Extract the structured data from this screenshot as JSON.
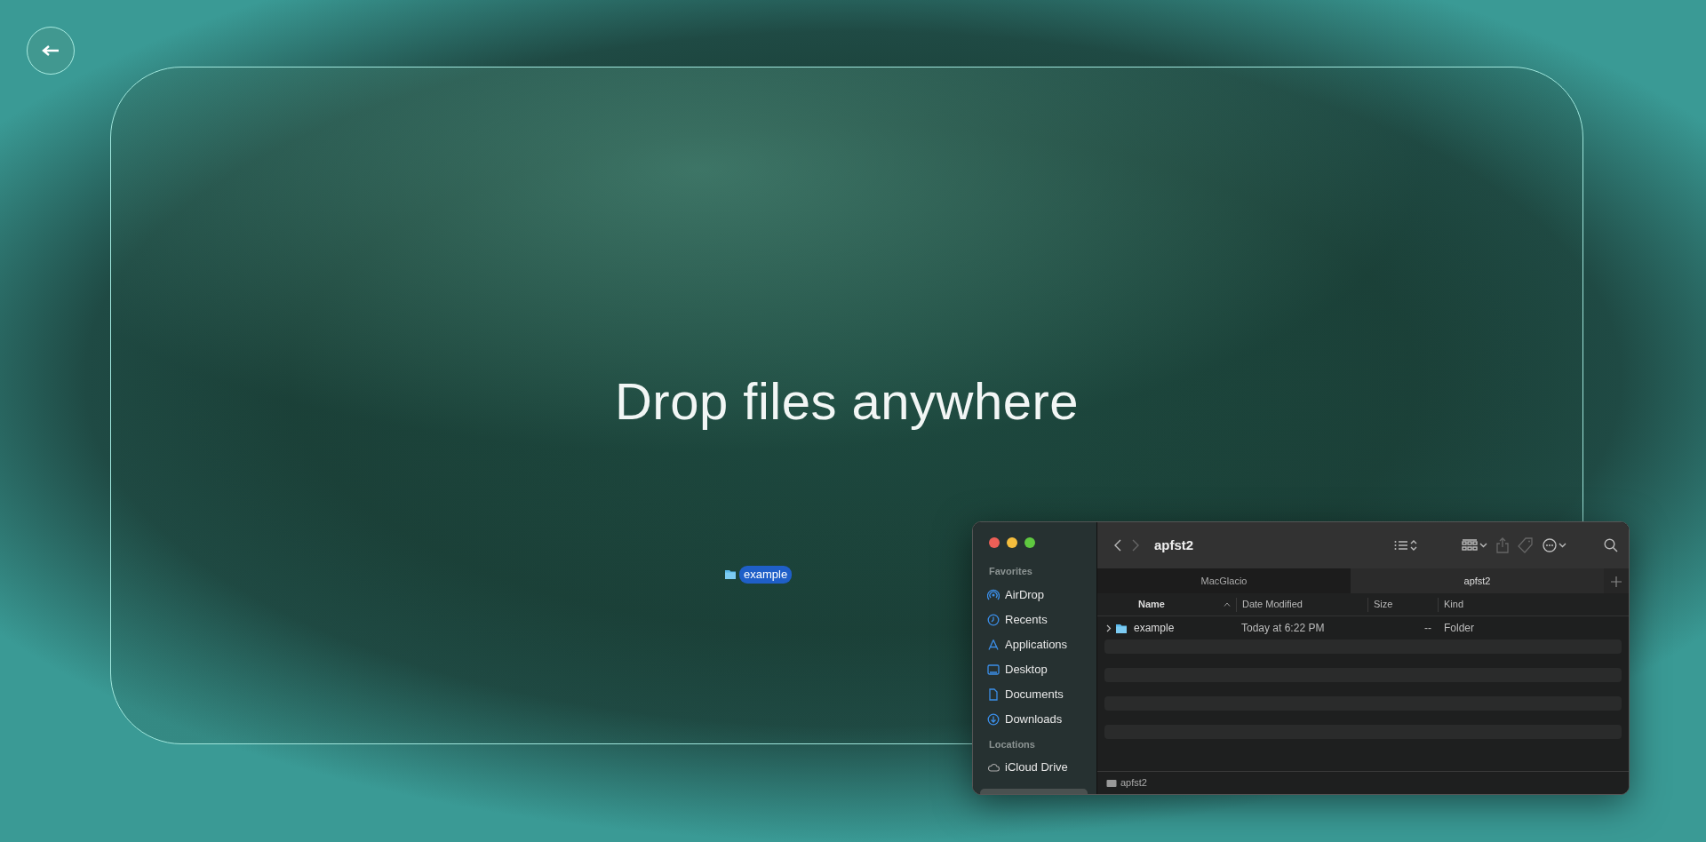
{
  "drop_zone": {
    "message": "Drop files anywhere"
  },
  "drag_item": {
    "label": "example",
    "selected": true
  },
  "finder": {
    "title": "apfst2",
    "sidebar": [
      {
        "heading": "Favorites",
        "items": [
          {
            "label": "AirDrop",
            "kind": "airdrop"
          },
          {
            "label": "Recents",
            "kind": "clock"
          },
          {
            "label": "Applications",
            "kind": "apps"
          },
          {
            "label": "Desktop",
            "kind": "desktop"
          },
          {
            "label": "Documents",
            "kind": "document"
          },
          {
            "label": "Downloads",
            "kind": "download"
          }
        ]
      },
      {
        "heading": "Locations",
        "items": [
          {
            "label": "iCloud Drive",
            "kind": "cloud"
          }
        ]
      }
    ],
    "tabs": [
      {
        "label": "MacGlacio",
        "selected": false
      },
      {
        "label": "apfst2",
        "selected": true
      }
    ],
    "columns": [
      {
        "label": "Name",
        "sorted": true
      },
      {
        "label": "Date Modified",
        "sorted": false
      },
      {
        "label": "Size",
        "sorted": false
      },
      {
        "label": "Kind",
        "sorted": false
      }
    ],
    "rows": [
      {
        "name": "example",
        "date_modified": "Today at 6:22 PM",
        "size": "--",
        "kind": "Folder"
      }
    ],
    "path_bar": "apfst2"
  }
}
